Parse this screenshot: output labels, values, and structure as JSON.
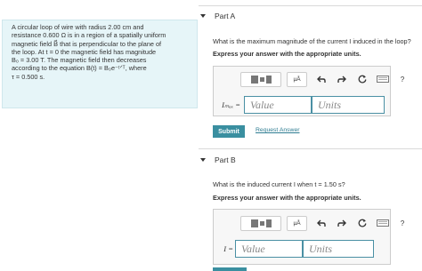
{
  "problem": {
    "lines": [
      "A circular loop of wire with radius 2.00 cm and",
      "resistance 0.600 Ω is in a region of a spatially uniform",
      "magnetic field B⃗ that is perpendicular to the plane of",
      "the loop. At t = 0 the magnetic field has magnitude",
      "B₀ = 3.00 T. The magnetic field then decreases",
      "according to the equation B(t) = B₀e⁻ᵗᐟᵀ, where",
      "τ = 0.500 s."
    ]
  },
  "part_a": {
    "title": "Part A",
    "question": "What is the maximum magnitude of the current I induced in the loop?",
    "instruction": "Express your answer with the appropriate units.",
    "units_button_label": "μÅ",
    "help_label": "?",
    "variable_label": "Iₘₐₓ =",
    "value_placeholder": "Value",
    "units_placeholder": "Units",
    "submit_label": "Submit",
    "request_answer_label": "Request Answer"
  },
  "part_b": {
    "title": "Part B",
    "question": "What is the induced current I when t = 1.50 s?",
    "instruction": "Express your answer with the appropriate units.",
    "units_button_label": "μÅ",
    "help_label": "?",
    "variable_label": "I =",
    "value_placeholder": "Value",
    "units_placeholder": "Units"
  },
  "toolbar_icons": [
    "templates-icon",
    "units-icon",
    "undo-icon",
    "redo-icon",
    "reset-icon",
    "keyboard-icon",
    "help-icon"
  ],
  "colors": {
    "problem_bg": "#e6f5f8",
    "accent": "#3a8fa0",
    "link": "#2f7d92",
    "field_border": "#4a90a4"
  }
}
